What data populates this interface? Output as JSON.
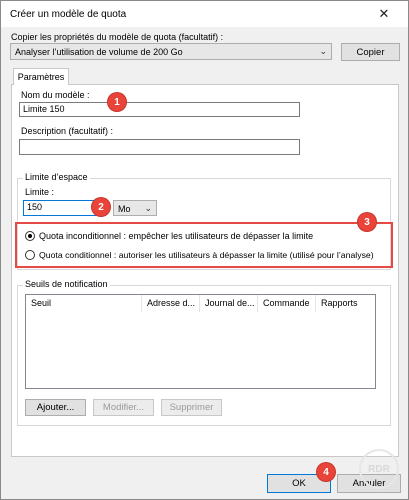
{
  "window": {
    "title": "Créer un modèle de quota",
    "close_glyph": "✕"
  },
  "copy_props": {
    "label": "Copier les propriétés du modèle de quota (facultatif) :",
    "selected": "Analyser l’utilisation de volume de 200 Go",
    "copy_button": "Copier"
  },
  "tabs": [
    {
      "label": "Paramètres"
    }
  ],
  "settings": {
    "name_label": "Nom du modèle :",
    "name_value": "Limite 150",
    "description_label": "Description (facultatif) :",
    "description_value": "",
    "space_limit": {
      "group_label": "Limite d’espace",
      "limit_label": "Limite :",
      "limit_value": "150",
      "unit": "Mo",
      "radio_hard": "Quota inconditionnel : empêcher les utilisateurs de dépasser la limite",
      "radio_soft": "Quota conditionnel : autoriser les utilisateurs à dépasser la limite (utilisé pour l’analyse)",
      "selected": "hard"
    },
    "notification": {
      "group_label": "Seuils de notification",
      "columns": [
        "Seuil",
        "Adresse d...",
        "Journal de...",
        "Commande",
        "Rapports"
      ],
      "rows": [],
      "add_button": "Ajouter...",
      "modify_button": "Modifier...",
      "delete_button": "Supprimer"
    }
  },
  "footer": {
    "ok_button": "OK",
    "cancel_button": "Annuler"
  },
  "annotations": {
    "badge_1": "1",
    "badge_2": "2",
    "badge_3": "3",
    "badge_4": "4",
    "accent_color": "#e9443a"
  },
  "watermark": {
    "text": "RDR"
  }
}
